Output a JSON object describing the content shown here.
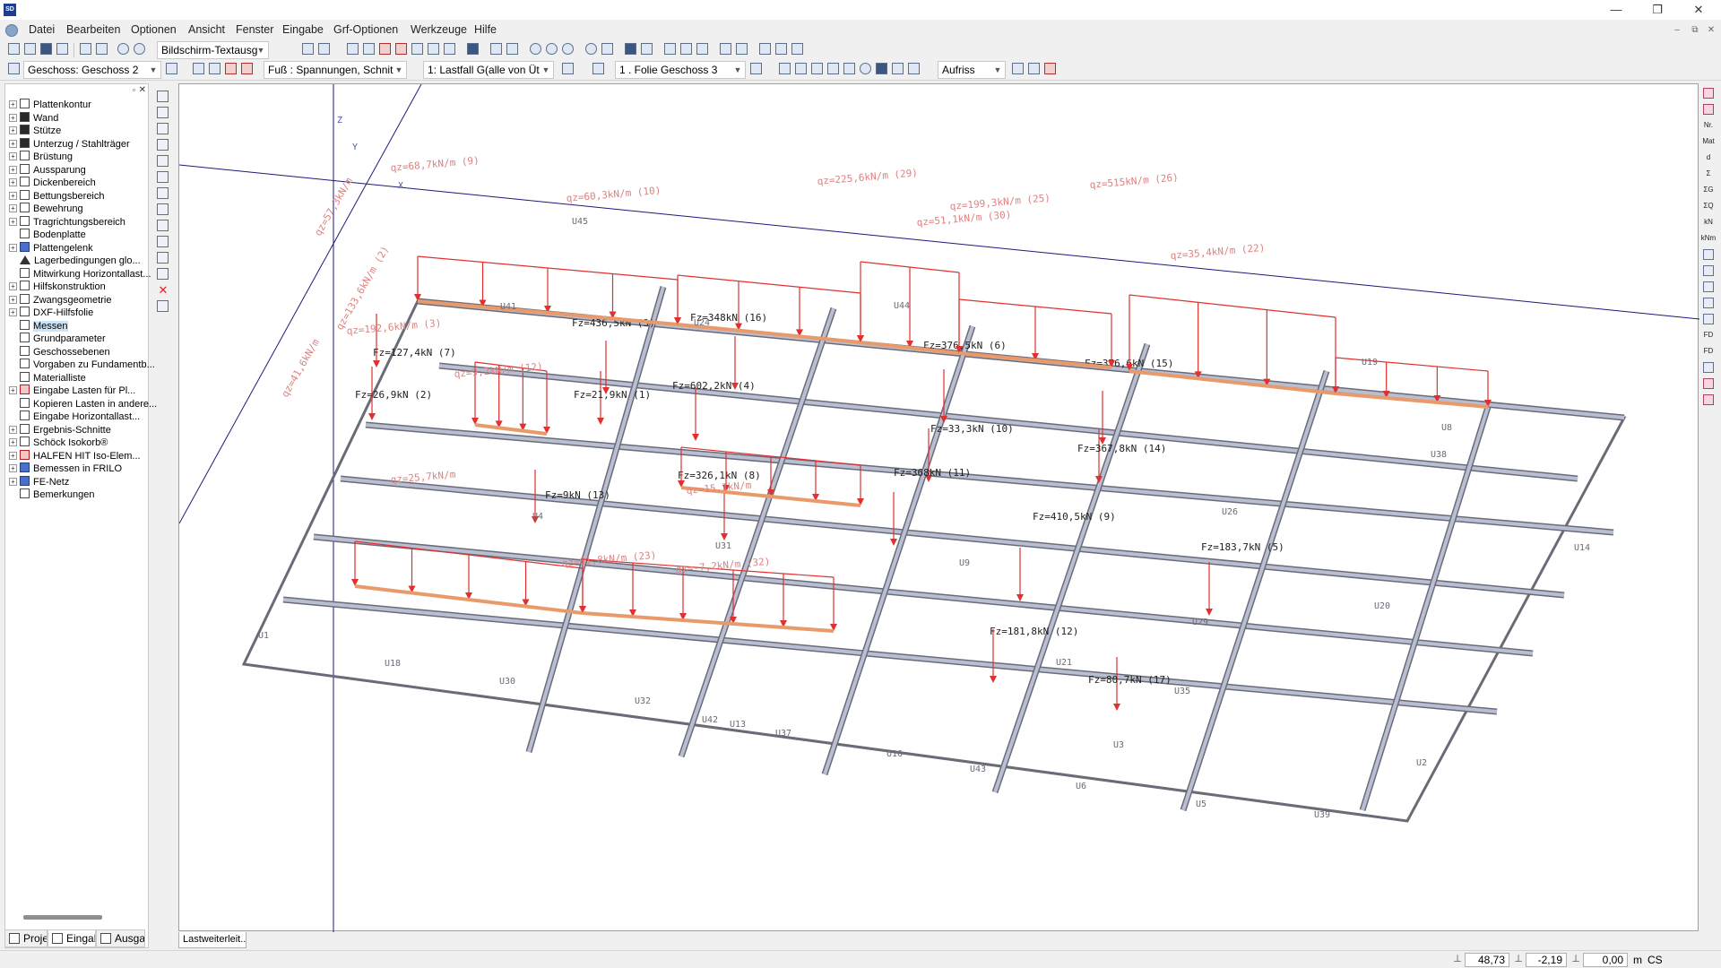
{
  "app": {
    "icon_text": "SD",
    "window_controls": [
      "—",
      "❐",
      "✕"
    ],
    "mdi_controls": [
      "–",
      "⧉",
      "✕"
    ]
  },
  "menu": {
    "items": [
      "Datei",
      "Bearbeiten",
      "Optionen",
      "Ansicht",
      "Fenster",
      "Eingabe",
      "Grf-Optionen",
      "Werkzeuge",
      "Hilfe"
    ]
  },
  "toolbar1": {
    "display_combo": "Bildschirm-Textausg"
  },
  "toolbar2": {
    "floor_combo": "Geschoss: Geschoss 2",
    "result_combo": "Fuß   : Spannungen, Schnit",
    "loadcase_combo": "1: Lastfall G(alle von Üt",
    "layer_combo": "1 . Folie Geschoss 3",
    "view_combo": "Aufriss"
  },
  "tree": {
    "items": [
      {
        "label": "Plattenkontur",
        "icon": "plate-contour-icon",
        "expandable": true
      },
      {
        "label": "Wand",
        "icon": "wall-icon",
        "expandable": true
      },
      {
        "label": "Stütze",
        "icon": "column-icon",
        "expandable": true
      },
      {
        "label": "Unterzug / Stahlträger",
        "icon": "beam-icon",
        "expandable": true
      },
      {
        "label": "Brüstung",
        "icon": "parapet-icon",
        "expandable": true
      },
      {
        "label": "Aussparung",
        "icon": "opening-icon",
        "expandable": true
      },
      {
        "label": "Dickenbereich",
        "icon": "thickness-area-icon",
        "expandable": true
      },
      {
        "label": "Bettungsbereich",
        "icon": "bedding-area-icon",
        "expandable": true
      },
      {
        "label": "Bewehrung",
        "icon": "reinforcement-icon",
        "expandable": true
      },
      {
        "label": "Tragrichtungsbereich",
        "icon": "span-direction-icon",
        "expandable": true
      },
      {
        "label": "Bodenplatte",
        "icon": "base-slab-icon",
        "expandable": false
      },
      {
        "label": "Plattengelenk",
        "icon": "plate-hinge-icon",
        "expandable": true
      },
      {
        "label": "Lagerbedingungen glo...",
        "icon": "support-icon",
        "expandable": false
      },
      {
        "label": "Mitwirkung Horizontallast...",
        "icon": "horizontal-load-icon",
        "expandable": false
      },
      {
        "label": "Hilfskonstruktion",
        "icon": "auxiliary-icon",
        "expandable": true
      },
      {
        "label": "Zwangsgeometrie",
        "icon": "constraint-icon",
        "expandable": true
      },
      {
        "label": "DXF-Hilfsfolie",
        "icon": "dxf-icon",
        "expandable": true
      },
      {
        "label": "Messen",
        "icon": "measure-icon",
        "expandable": false,
        "selected": true
      },
      {
        "label": "Grundparameter",
        "icon": "parameters-icon",
        "expandable": false
      },
      {
        "label": "Geschossebenen",
        "icon": "floor-levels-icon",
        "expandable": false
      },
      {
        "label": "Vorgaben zu Fundamentb...",
        "icon": "foundation-icon",
        "expandable": false
      },
      {
        "label": "Materialliste",
        "icon": "material-list-icon",
        "expandable": false
      },
      {
        "label": "Eingabe Lasten für Pl...",
        "icon": "load-input-icon",
        "expandable": true
      },
      {
        "label": "Kopieren Lasten in andere...",
        "icon": "copy-loads-icon",
        "expandable": false
      },
      {
        "label": "Eingabe Horizontallast...",
        "icon": "horizontal-input-icon",
        "expandable": false
      },
      {
        "label": "Ergebnis-Schnitte",
        "icon": "result-section-icon",
        "expandable": true
      },
      {
        "label": "Schöck Isokorb®",
        "icon": "isokorb-icon",
        "expandable": true
      },
      {
        "label": "HALFEN HIT Iso-Elem...",
        "icon": "halfen-icon",
        "expandable": true
      },
      {
        "label": "Bemessen in FRILO",
        "icon": "frilo-icon",
        "expandable": true
      },
      {
        "label": "FE-Netz",
        "icon": "fe-mesh-icon",
        "expandable": true
      },
      {
        "label": "Bemerkungen",
        "icon": "remarks-icon",
        "expandable": false
      }
    ]
  },
  "panel_tabs": [
    "Proje",
    "Eingab",
    "Ausga"
  ],
  "canvas": {
    "tab_label": "Lastweiterleit...",
    "axis_labels": {
      "z": "Z",
      "y": "Y",
      "x": "X"
    }
  },
  "status": {
    "x_value": "48,73",
    "y_value": "-2,19",
    "z_value": "0,00",
    "unit": "m",
    "cs": "CS"
  },
  "colors": {
    "load": "#e03030",
    "load_text": "#e08080",
    "structure": "#6b6b78",
    "beam_fill": "#b9bfd2",
    "axis": "#1a1a7a"
  },
  "model": {
    "point_loads": [
      "Fz=127,4kN (7)",
      "Fz=436,5kN (3)",
      "Fz=348kN (16)",
      "Fz=376,5kN (6)",
      "Fz=26,9kN (2)",
      "Fz=21,9kN (1)",
      "Fz=602,2kN (4)",
      "Fz=376,6kN (15)",
      "Fz=33,3kN (10)",
      "Fz=367,8kN (14)",
      "Fz=326,1kN (8)",
      "Fz=368kN (11)",
      "Fz=9kN (13)",
      "Fz=410,5kN (9)",
      "Fz=183,7kN (5)",
      "Fz=181,8kN (12)",
      "Fz=80,7kN (17)"
    ],
    "line_loads": [
      "qz=68,7kN/m (9)",
      "qz=225,6kN/m (29)",
      "qz=60,3kN/m (10)",
      "qz=199,3kN/m (25)",
      "qz=515kN/m (26)",
      "qz=51,1kN/m (30)",
      "qz=35,4kN/m (22)",
      "qz=192,6kN/m (3)",
      "qz=133,6kN/m (2)",
      "qz=9,2kN/m (12)",
      "qz=25,7kN/m",
      "qz=61,8kN/m (23)",
      "qz=-7,2kN/m (32)",
      "qz=15,1kN/m",
      "qz=57,3kN/m",
      "qz=41,6kN/m"
    ],
    "member_labels": [
      "U45",
      "U41",
      "U44",
      "U24",
      "U19",
      "U8",
      "U38",
      "U26",
      "U4",
      "U31",
      "U9",
      "U29",
      "U18",
      "U30",
      "U32",
      "U42",
      "U13",
      "U37",
      "U16",
      "U43",
      "U6",
      "U5",
      "U39",
      "U1",
      "U2",
      "U3",
      "U35",
      "U20",
      "U21",
      "U14"
    ]
  }
}
